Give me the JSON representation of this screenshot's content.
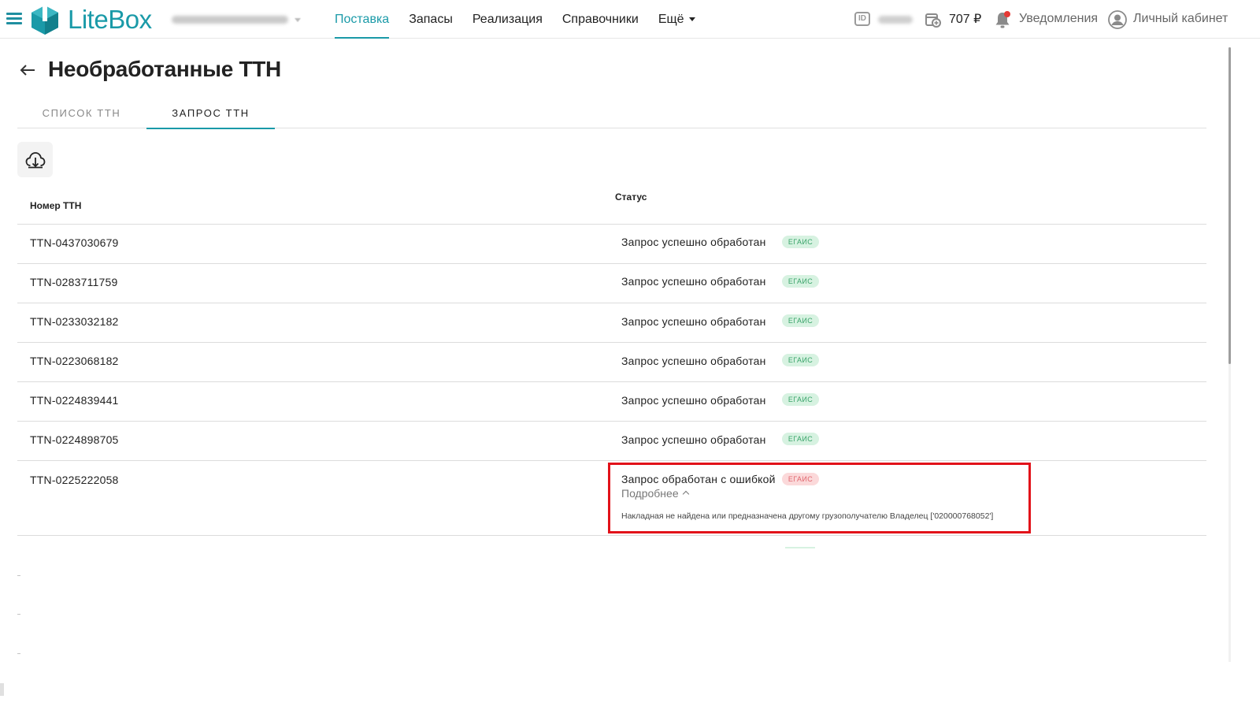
{
  "app": {
    "logo_text": "LiteBox"
  },
  "nav": {
    "items": [
      {
        "label": "Поставка",
        "active": true
      },
      {
        "label": "Запасы"
      },
      {
        "label": "Реализация"
      },
      {
        "label": "Справочники"
      },
      {
        "label": "Ещё",
        "dropdown": true
      }
    ]
  },
  "header_right": {
    "balance": "707 ₽",
    "notifications_label": "Уведомления",
    "account_label": "Личный кабинет"
  },
  "page": {
    "title": "Необработанные ТТН",
    "tabs": [
      {
        "label": "СПИСОК ТТН",
        "active": false
      },
      {
        "label": "ЗАПРОС ТТН",
        "active": true
      }
    ]
  },
  "table": {
    "columns": {
      "number": "Номер ТТН",
      "status": "Статус"
    },
    "rows": [
      {
        "number": "TTN-0437030679",
        "status": "Запрос успешно обработан",
        "badge": "ЕГАИС",
        "state": "ok"
      },
      {
        "number": "TTN-0283711759",
        "status": "Запрос успешно обработан",
        "badge": "ЕГАИС",
        "state": "ok"
      },
      {
        "number": "TTN-0233032182",
        "status": "Запрос успешно обработан",
        "badge": "ЕГАИС",
        "state": "ok"
      },
      {
        "number": "TTN-0223068182",
        "status": "Запрос успешно обработан",
        "badge": "ЕГАИС",
        "state": "ok"
      },
      {
        "number": "TTN-0224839441",
        "status": "Запрос успешно обработан",
        "badge": "ЕГАИС",
        "state": "ok"
      },
      {
        "number": "TTN-0224898705",
        "status": "Запрос успешно обработан",
        "badge": "ЕГАИС",
        "state": "ok"
      },
      {
        "number": "TTN-0225222058",
        "status": "Запрос обработан с ошибкой",
        "badge": "ЕГАИС",
        "state": "error",
        "details_label": "Подробнее",
        "error_message": "Накладная не найдена или предназначена другому грузополучателю Владелец ['020000768052']"
      }
    ]
  },
  "colors": {
    "accent": "#1a9aa8",
    "badge_ok_bg": "#d7f2e1",
    "badge_ok_text": "#3aa46a",
    "badge_err_bg": "#fbd9da",
    "badge_err_text": "#e0686f",
    "highlight": "#e2121a"
  },
  "icons": [
    "menu-icon",
    "litebox-logo-icon",
    "id-icon",
    "wallet-icon",
    "bell-icon",
    "user-avatar-icon",
    "back-arrow-icon",
    "cloud-download-icon",
    "chevron-up-icon",
    "caret-down-icon"
  ]
}
